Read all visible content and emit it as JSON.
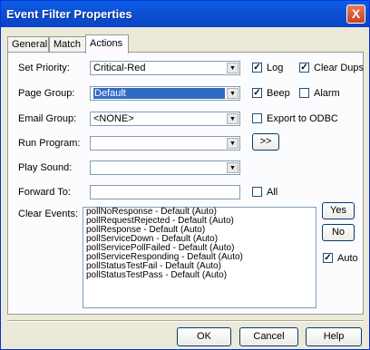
{
  "window": {
    "title": "Event Filter Properties",
    "close_glyph": "X"
  },
  "tabs": [
    {
      "label": "General"
    },
    {
      "label": "Match"
    },
    {
      "label": "Actions"
    }
  ],
  "fields": {
    "set_priority": {
      "label": "Set Priority:",
      "value": "Critical-Red"
    },
    "page_group": {
      "label": "Page Group:",
      "value": "Default"
    },
    "email_group": {
      "label": "Email Group:",
      "value": "<NONE>"
    },
    "run_program": {
      "label": "Run Program:",
      "value": "",
      "browse_label": ">>"
    },
    "play_sound": {
      "label": "Play Sound:",
      "value": ""
    },
    "forward_to": {
      "label": "Forward To:",
      "value": ""
    }
  },
  "checkboxes": {
    "log": {
      "label": "Log",
      "checked": true
    },
    "clear_dups": {
      "label": "Clear Dups",
      "checked": true
    },
    "beep": {
      "label": "Beep",
      "checked": true
    },
    "alarm": {
      "label": "Alarm",
      "checked": false
    },
    "export_odbc": {
      "label": "Export to ODBC",
      "checked": false
    },
    "all": {
      "label": "All",
      "checked": false
    },
    "auto": {
      "label": "Auto",
      "checked": true
    }
  },
  "clear_events": {
    "label": "Clear Events:",
    "items": [
      "pollNoResponse - Default (Auto)",
      "pollRequestRejected - Default (Auto)",
      "pollResponse - Default (Auto)",
      "pollServiceDown - Default (Auto)",
      "pollServicePollFailed - Default (Auto)",
      "pollServiceResponding - Default (Auto)",
      "pollStatusTestFail - Default (Auto)",
      "pollStatusTestPass - Default (Auto)"
    ],
    "yes_label": "Yes",
    "no_label": "No"
  },
  "footer": {
    "ok_label": "OK",
    "cancel_label": "Cancel",
    "help_label": "Help"
  },
  "check_mark": "✓",
  "arrow_glyph": "▼"
}
